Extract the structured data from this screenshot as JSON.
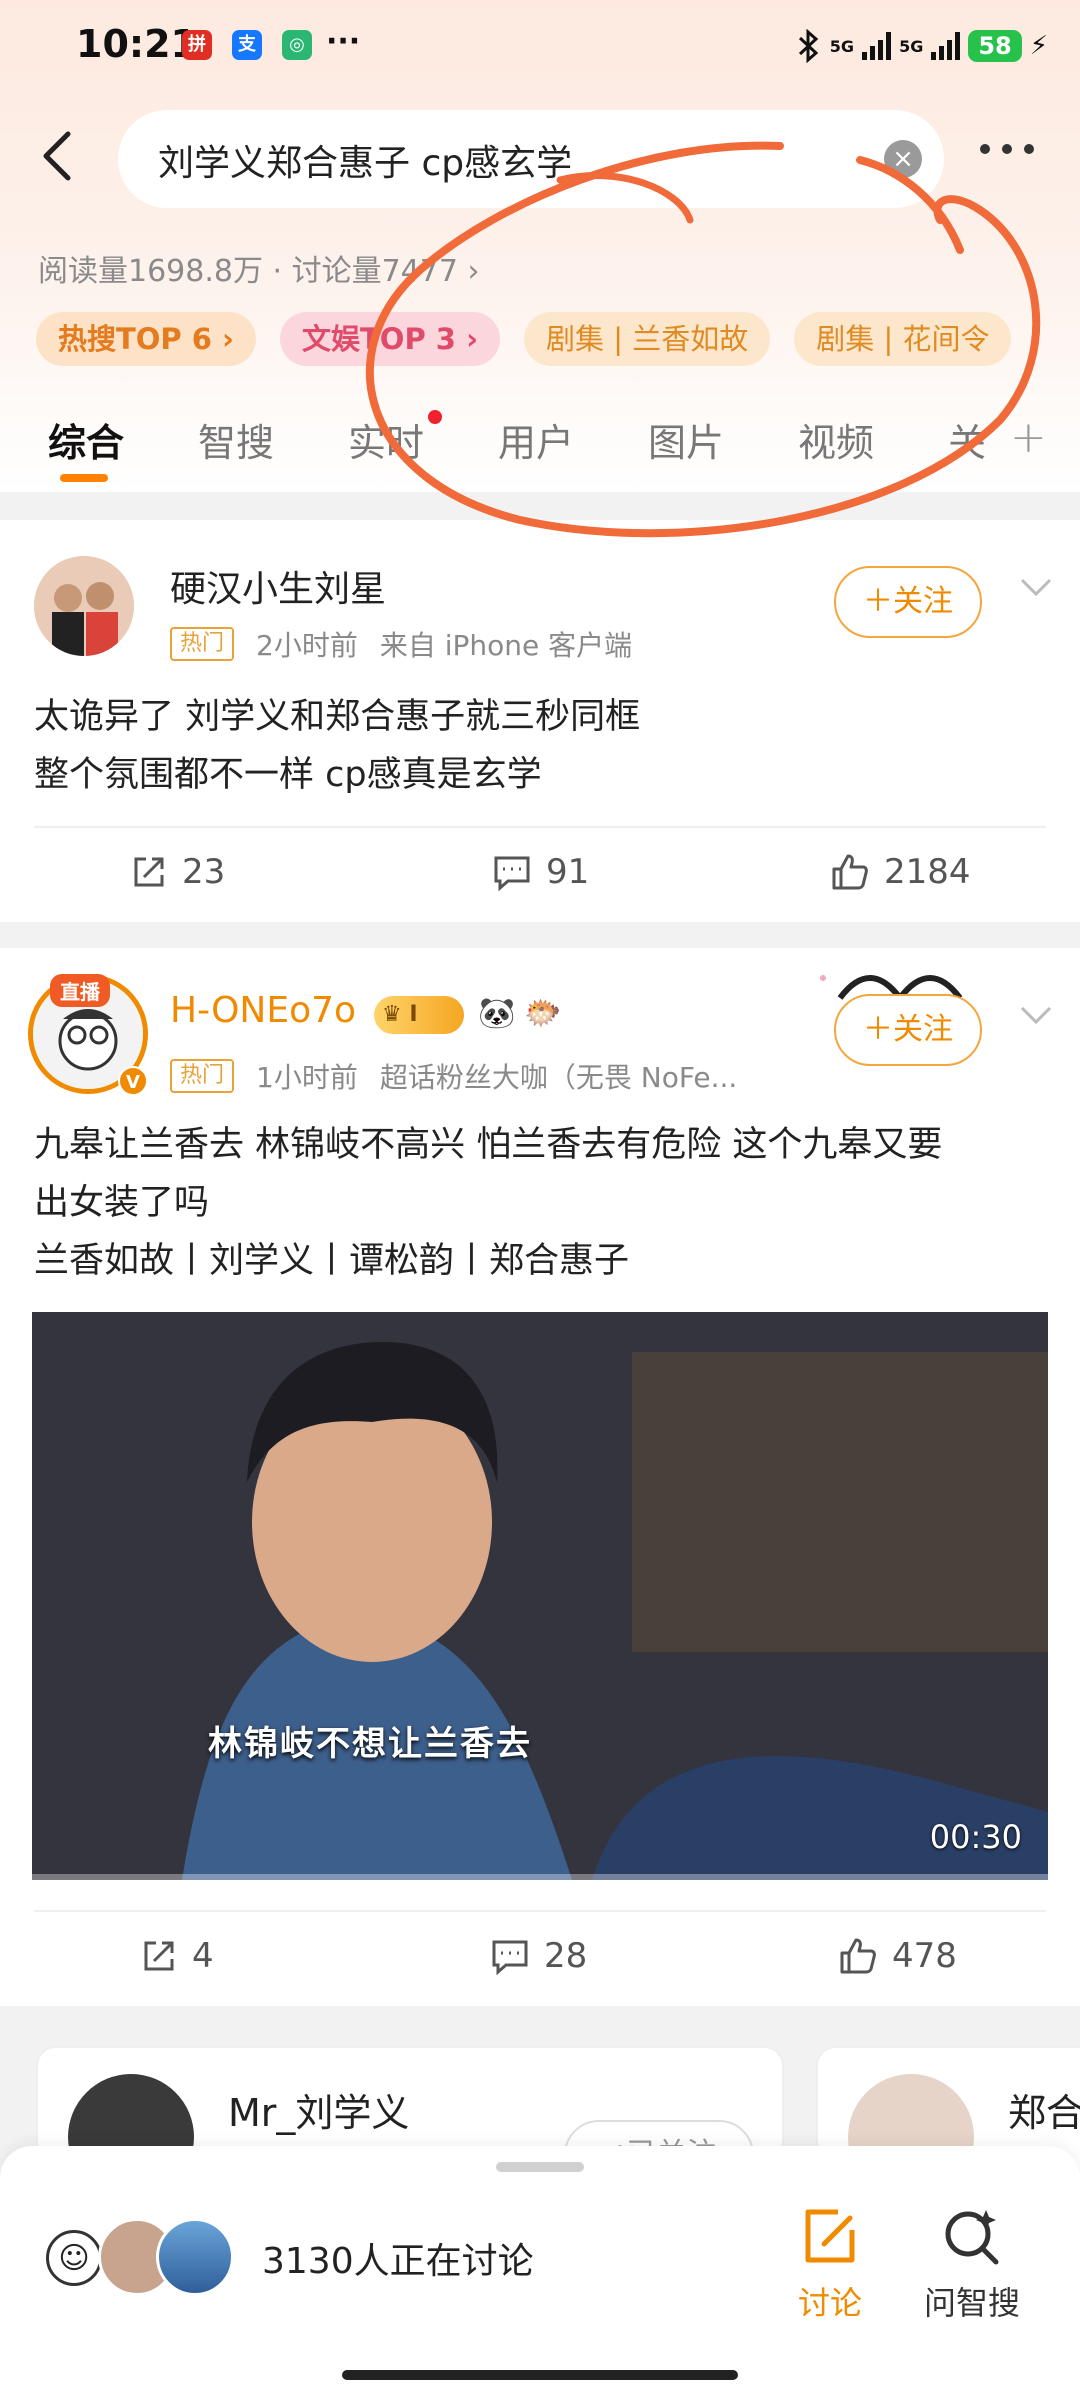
{
  "status_bar": {
    "time": "10:21",
    "dots": "···",
    "network1": "5G",
    "network2": "5G",
    "battery": "58",
    "app_icons": [
      "pinduoduo-icon",
      "alipay-icon",
      "app-icon"
    ]
  },
  "search": {
    "query": "刘学义郑合惠子 cp感玄学"
  },
  "stats": {
    "text": "阅读量1698.8万 · 讨论量7477 ›"
  },
  "chips": [
    {
      "label": "热搜TOP 6 ›",
      "style": "hot"
    },
    {
      "label": "文娱TOP 3 ›",
      "style": "ent"
    },
    {
      "label": "剧集 | 兰香如故",
      "style": "tv"
    },
    {
      "label": "剧集 | 花间令",
      "style": "tv"
    }
  ],
  "tabs": [
    "综合",
    "智搜",
    "实时",
    "用户",
    "图片",
    "视频",
    "关"
  ],
  "colors": {
    "accent": "#ff8200",
    "annotation": "#f06a3a",
    "follow": "#f08a00"
  },
  "posts": [
    {
      "username": "硬汉小生刘星",
      "badge": "热门",
      "time": "2小时前",
      "source": "来自 iPhone 客户端",
      "follow": "＋关注",
      "text_line1": "太诡异了 刘学义和郑合惠子就三秒同框",
      "text_line2": "整个氛围都不一样 cp感真是玄学",
      "reposts": "23",
      "comments": "91",
      "likes": "2184"
    },
    {
      "username": "H-ONEo7o",
      "live_badge": "直播",
      "level_badge": "I",
      "badge": "热门",
      "time": "1小时前",
      "source": "超话粉丝大咖（无畏 NoFe...",
      "follow": "＋关注",
      "text_line1": "九皋让兰香去 林锦岐不高兴 怕兰香去有危险 这个九皋又要",
      "text_line2": "出女装了吗",
      "text_line3": "兰香如故丨刘学义丨谭松韵丨郑合惠子",
      "video_subtitle": "林锦岐不想让兰香去",
      "video_duration": "00:30",
      "reposts": "4",
      "comments": "28",
      "likes": "478"
    }
  ],
  "recommended": [
    {
      "name": "Mr_刘学义",
      "status": "✓已关注"
    },
    {
      "name": "郑合"
    }
  ],
  "bottom_sheet": {
    "discussion": "3130人正在讨论",
    "discuss_label": "讨论",
    "ask_label": "问智搜"
  }
}
